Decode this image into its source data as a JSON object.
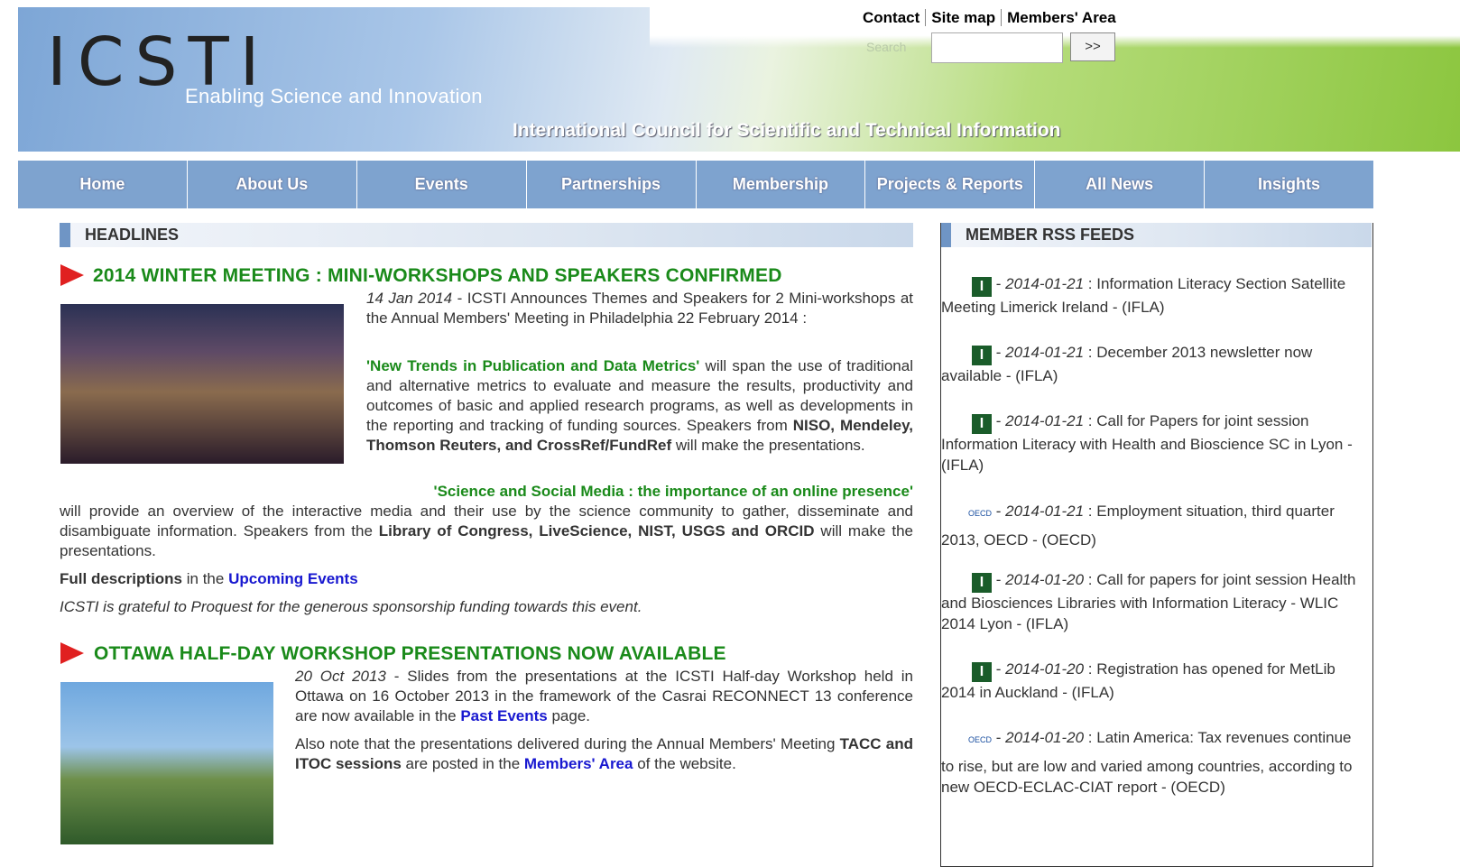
{
  "header": {
    "logo": "ICSTI",
    "tagline": "Enabling Science and Innovation",
    "org_name": "International Council for Scientific and Technical Information",
    "links": [
      "Contact",
      "Site map",
      "Members' Area"
    ],
    "search_label": "Search",
    "search_button": ">>"
  },
  "nav": [
    "Home",
    "About Us",
    "Events",
    "Partnerships",
    "Membership",
    "Projects & Reports",
    "All News",
    "Insights"
  ],
  "headlines": {
    "title": "HEADLINES",
    "item1": {
      "title": "2014 WINTER MEETING : MINI-WORKSHOPS AND SPEAKERS CONFIRMED",
      "date": "14 Jan 2014",
      "intro": " - ICSTI Announces Themes and Speakers for 2 Mini-workshops at the Annual Members' Meeting in Philadelphia 22 February 2014 :",
      "theme1": "'New Trends in Publication and Data Metrics'",
      "theme1_text": " will span the use of traditional and alternative metrics to evaluate and measure the results, productivity and outcomes of basic and applied research programs, as well as developments in the reporting and tracking of funding sources. Speakers from ",
      "theme1_speakers": "NISO, Mendeley, Thomson Reuters, and CrossRef/FundRef",
      "theme1_end": " will make the presentations.",
      "theme2": "'Science and Social Media : the importance of an online presence'",
      "theme2_text": " will provide an overview of the interactive media and their use by the science community to gather, disseminate and disambiguate information. Speakers from the ",
      "theme2_speakers": "Library of Congress, LiveScience, NIST, USGS and ORCID",
      "theme2_end": " will make the presentations.",
      "full_prefix": "Full descriptions",
      "full_mid": " in the ",
      "full_link": "Upcoming Events",
      "sponsor": "ICSTI is grateful to Proquest for the generous sponsorship funding towards this event."
    },
    "item2": {
      "title": "OTTAWA HALF-DAY WORKSHOP PRESENTATIONS NOW AVAILABLE",
      "date": "20 Oct 2013",
      "text": " - Slides from the presentations at the ICSTI Half-day Workshop held in Ottawa on 16 October 2013 in the framework of the Casrai RECONNECT 13 conference are now available in the ",
      "link": "Past Events",
      "text_end": " page.",
      "p2_start": "Also note that the presentations delivered during the Annual Members' Meeting ",
      "p2_bold": "TACC and ITOC sessions",
      "p2_mid": " are posted in the ",
      "p2_link": "Members' Area",
      "p2_end": " of the website."
    }
  },
  "rss": {
    "title": "MEMBER RSS FEEDS",
    "items": [
      {
        "icon": "I",
        "date": "2014-01-21",
        "text": " : Information Literacy Section Satellite Meeting Limerick Ireland - (IFLA)"
      },
      {
        "icon": "I",
        "date": "2014-01-21",
        "text": " : December 2013 newsletter now available - (IFLA)"
      },
      {
        "icon": "I",
        "date": "2014-01-21",
        "text": " : Call for Papers for joint session Information Literacy with Health and Bioscience SC in Lyon - (IFLA)"
      },
      {
        "icon": "OECD",
        "date": "2014-01-21",
        "text": " : Employment situation, third quarter 2013, OECD - (OECD)"
      },
      {
        "icon": "I",
        "date": "2014-01-20",
        "text": " : Call for papers for joint session Health and Biosciences Libraries with Information Literacy - WLIC 2014 Lyon - (IFLA)"
      },
      {
        "icon": "I",
        "date": "2014-01-20",
        "text": " : Registration has opened for MetLib 2014 in Auckland - (IFLA)"
      },
      {
        "icon": "OECD",
        "date": "2014-01-20",
        "text": " : Latin America: Tax revenues continue to rise, but are low and varied among countries, according to new OECD-ECLAC-CIAT report - (OECD)"
      }
    ]
  }
}
